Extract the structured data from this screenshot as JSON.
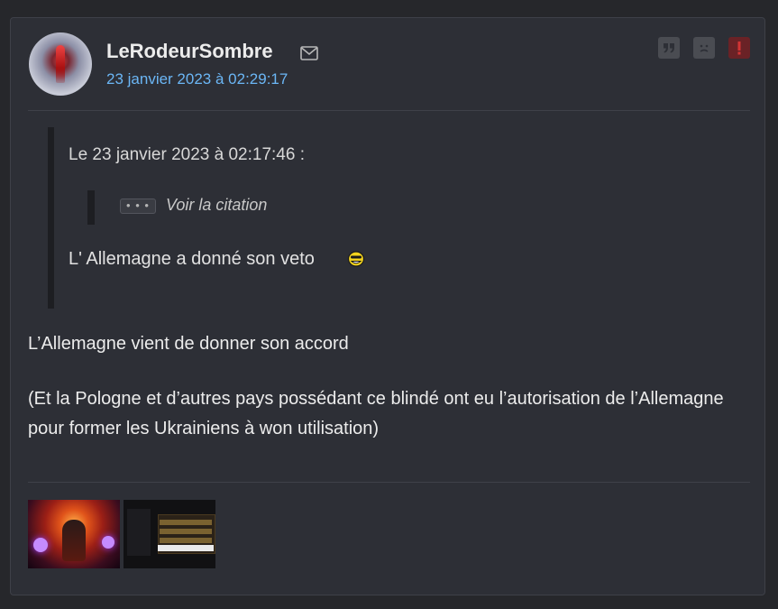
{
  "post": {
    "username": "LeRodeurSombre",
    "date": "23 janvier 2023 à 02:29:17",
    "actions": {
      "quote_icon": "quote-icon",
      "sad_icon": "sad-face-icon",
      "report_icon": "report-icon"
    },
    "quote": {
      "header": "Le 23 janvier 2023 à 02:17:46 :",
      "nested_label": "Voir la citation",
      "nested_ellipsis": "• • •",
      "text": "L' Allemagne a donné son veto"
    },
    "body": {
      "line1": "L’Allemagne vient de donner son accord",
      "para2": "(Et la Pologne et d’autres pays possédant ce blindé ont eu l’autorisation de l’Allemagne pour former les Ukrainiens à won utilisation)"
    }
  },
  "colors": {
    "background": "#26272b",
    "card": "#2d2f36",
    "date_link": "#6bb6f5",
    "report": "#6a2226"
  }
}
